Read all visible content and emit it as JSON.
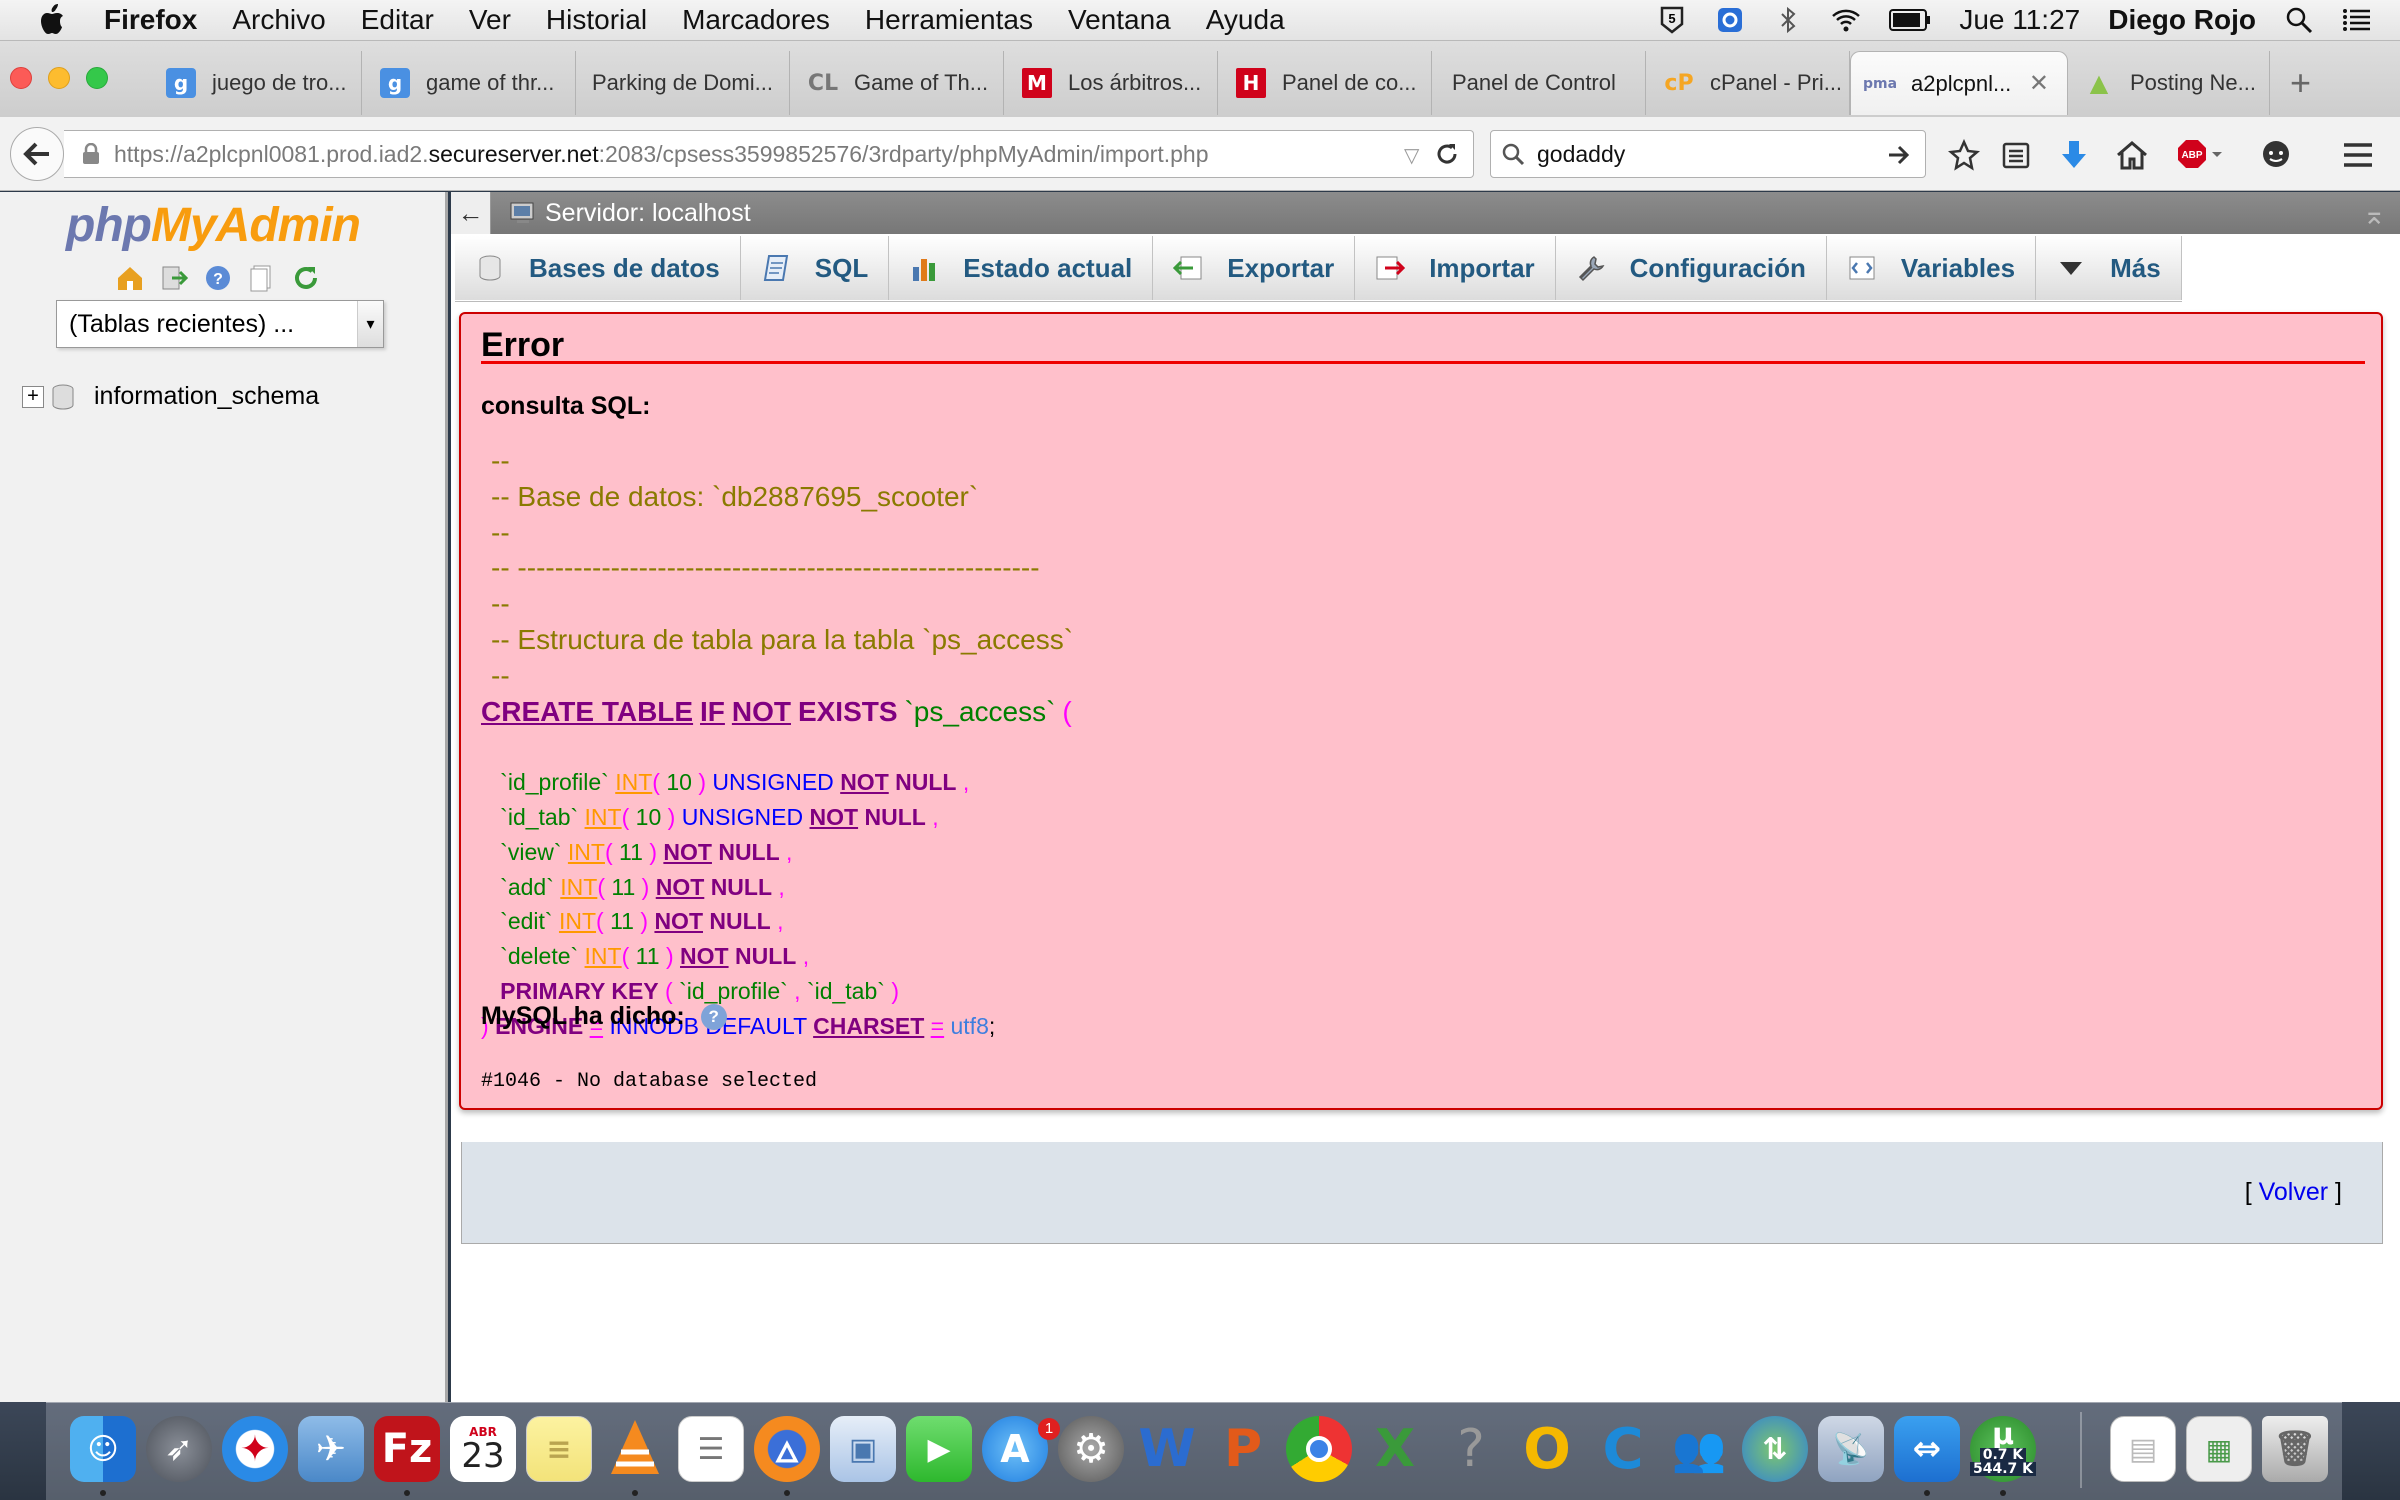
{
  "menubar": {
    "items": [
      "Firefox",
      "Archivo",
      "Editar",
      "Ver",
      "Historial",
      "Marcadores",
      "Herramientas",
      "Ventana",
      "Ayuda"
    ],
    "clock": "Jue 11:27",
    "user": "Diego Rojo",
    "status_icons": [
      "5-icon",
      "app-icon",
      "bluetooth-icon",
      "wifi-icon",
      "battery-icon",
      "search-icon",
      "list-icon"
    ]
  },
  "tabs": [
    {
      "label": "juego de tro...",
      "icon": "google-icon",
      "color": "#4a90e2",
      "glyph": "g"
    },
    {
      "label": "game of thr...",
      "icon": "google-icon",
      "color": "#4a90e2",
      "glyph": "g"
    },
    {
      "label": "Parking de Domi...",
      "icon": "none",
      "color": "",
      "glyph": ""
    },
    {
      "label": "Game of Th...",
      "icon": "craigslist-icon",
      "color": "#888888",
      "glyph": "CL"
    },
    {
      "label": "Los árbitros...",
      "icon": "marca-icon",
      "color": "#d0021b",
      "glyph": "M"
    },
    {
      "label": "Panel de co...",
      "icon": "hostgator-icon",
      "color": "#d0021b",
      "glyph": "H"
    },
    {
      "label": "Panel de Control",
      "icon": "none",
      "color": "",
      "glyph": ""
    },
    {
      "label": "cPanel - Pri...",
      "icon": "cpanel-icon",
      "color": "#f5a623",
      "glyph": "cP"
    },
    {
      "label": "a2plcpnl...",
      "icon": "phpmyadmin-icon",
      "color": "#6c78af",
      "glyph": "pma",
      "active": true
    },
    {
      "label": "Posting Ne...",
      "icon": "android-icon",
      "color": "#8bc34a",
      "glyph": "A"
    }
  ],
  "nav": {
    "url_prefix": "https://a2plcpnl0081.prod.iad2.",
    "url_domain": "secureserver.net",
    "url_suffix": ":2083/cpsess3599852576/3rdparty/phpMyAdmin/import.php",
    "search_value": "godaddy"
  },
  "sidebar": {
    "logo_php": "php",
    "logo_myadmin": "MyAdmin",
    "recent_tables": "(Tablas recientes) ...",
    "databases": [
      "information_schema"
    ]
  },
  "main": {
    "server_label": "Servidor: localhost",
    "tabs": [
      {
        "label": "Bases de datos",
        "icon": "database-icon"
      },
      {
        "label": "SQL",
        "icon": "sql-icon"
      },
      {
        "label": "Estado actual",
        "icon": "status-icon"
      },
      {
        "label": "Exportar",
        "icon": "export-icon"
      },
      {
        "label": "Importar",
        "icon": "import-icon"
      },
      {
        "label": "Configuración",
        "icon": "wrench-icon"
      },
      {
        "label": "Variables",
        "icon": "variables-icon"
      },
      {
        "label": "Más",
        "icon": "triangle-down-icon"
      }
    ],
    "error": {
      "title": "Error",
      "sql_label": "consulta SQL:",
      "comments": [
        "--",
        "-- Base de datos: `db2887695_scooter`",
        "--",
        "-- --------------------------------------------------------",
        "--",
        "-- Estructura de tabla para la tabla `ps_access`",
        "--"
      ],
      "mysql_said": "MySQL ha dicho:",
      "message": "#1046 - No database selected"
    },
    "back_link": "Volver"
  },
  "dock": {
    "apps": [
      "finder",
      "launchpad",
      "safari",
      "mail",
      "filezilla",
      "calendar",
      "notes",
      "vlc",
      "reminders",
      "firefox",
      "preview",
      "facetime",
      "app-store",
      "system-preferences",
      "word",
      "powerpoint",
      "chrome",
      "excel",
      "help",
      "office",
      "coda",
      "messenger",
      "network",
      "ftp",
      "teamviewer",
      "utorrent",
      "documents",
      "settings-window",
      "trash"
    ],
    "calendar_month": "ABR",
    "calendar_day": "23",
    "appstore_badge": "1",
    "utorrent_up": "0.7 K",
    "utorrent_down": "544.7 K"
  }
}
